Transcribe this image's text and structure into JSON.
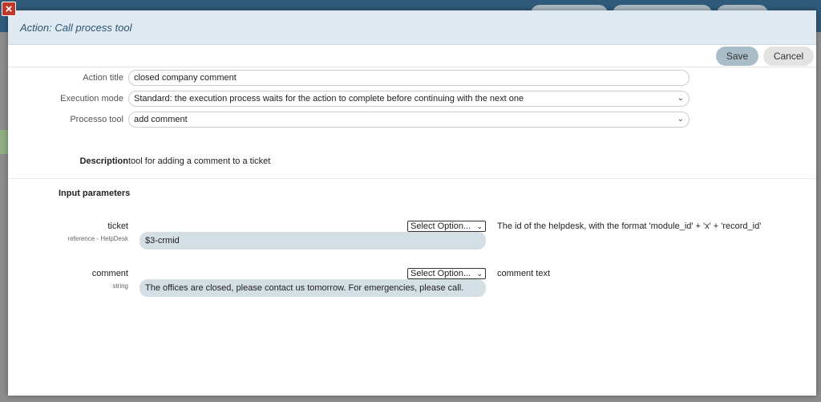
{
  "modal": {
    "title": "Action: Call process tool"
  },
  "toolbar": {
    "save_label": "Save",
    "cancel_label": "Cancel"
  },
  "form": {
    "action_title_label": "Action title",
    "action_title_value": "closed company comment",
    "execution_mode_label": "Execution mode",
    "execution_mode_value": "Standard: the execution process waits for the action to complete before continuing with the next one",
    "process_tool_label": "Processo tool",
    "process_tool_value": "add comment",
    "description_label": "Description",
    "description_text": "tool for adding a comment to a ticket",
    "input_parameters_label": "Input parameters"
  },
  "params": [
    {
      "name": "ticket",
      "type": "reference - HelpDesk",
      "select_label": "Select Option...",
      "value": "$3-crmid",
      "help": "The id of the helpdesk, with the format 'module_id' + 'x' + 'record_id'"
    },
    {
      "name": "comment",
      "type": "string",
      "select_label": "Select Option...",
      "value": "The offices are closed, please contact us tomorrow. For emergencies, please call.",
      "help": "comment text"
    }
  ],
  "icons": {
    "close": "close-icon",
    "chevron": "chevron-down-icon"
  },
  "colors": {
    "header_bg": "#dfe9f2",
    "title_color": "#2d5470",
    "save_bg": "#a9bdc9",
    "param_value_bg": "#d4dee5",
    "close_red": "#c0392b"
  }
}
